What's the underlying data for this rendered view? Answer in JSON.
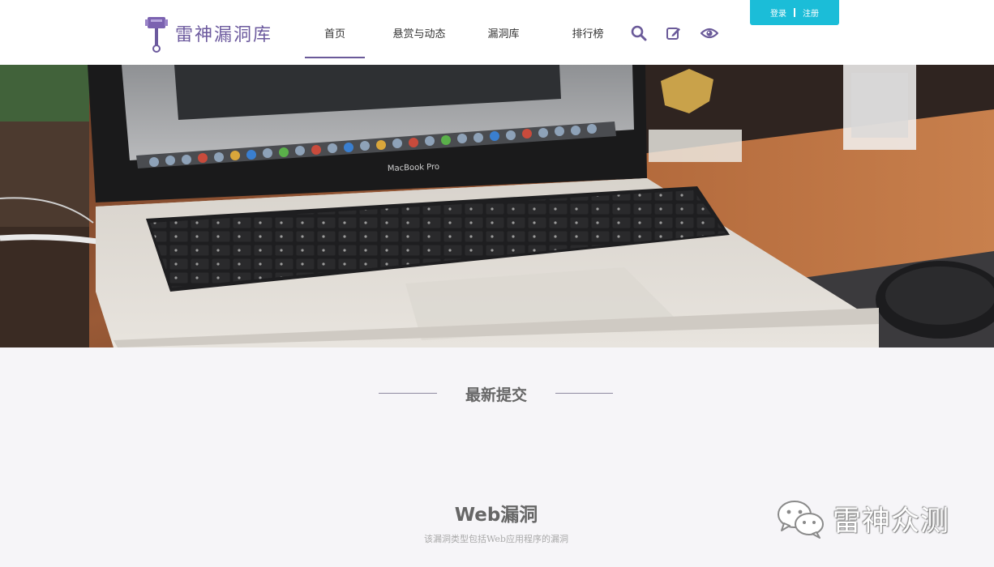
{
  "site": {
    "logo_text": "雷神漏洞库",
    "brand_color": "#6c5a9e"
  },
  "nav": {
    "items": [
      {
        "label": "首页",
        "active": true
      },
      {
        "label": "悬赏与动态",
        "active": false
      },
      {
        "label": "漏洞库",
        "active": false
      },
      {
        "label": "排行榜",
        "active": false
      }
    ]
  },
  "toolbar": {
    "icons": [
      "search-icon",
      "edit-icon",
      "eye-icon"
    ]
  },
  "auth": {
    "login_label": "登录",
    "register_label": "注册",
    "color": "#1bbdd8"
  },
  "hero": {
    "laptop_brand": "MacBook Pro"
  },
  "main": {
    "section_title": "最新提交",
    "category": {
      "title": "Web漏洞",
      "description": "该漏洞类型包括Web应用程序的漏洞"
    }
  },
  "watermark": {
    "text": "雷神众测",
    "icon": "wechat-icon"
  }
}
